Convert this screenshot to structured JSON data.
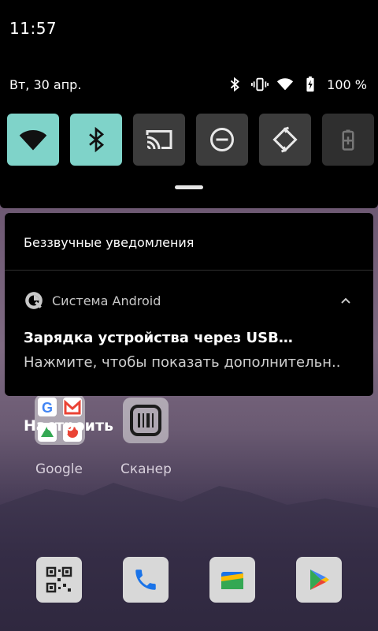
{
  "statusbar": {
    "time": "11:57",
    "date": "Вт, 30 апр.",
    "battery_percent": "100 %",
    "icons": [
      "bluetooth-icon",
      "vibrate-icon",
      "wifi-icon",
      "battery-charging-icon"
    ]
  },
  "quick_settings": {
    "tiles": [
      {
        "name": "wifi",
        "icon": "wifi-icon",
        "state": "on"
      },
      {
        "name": "bluetooth",
        "icon": "bluetooth-icon",
        "state": "on"
      },
      {
        "name": "cast",
        "icon": "cast-icon",
        "state": "off"
      },
      {
        "name": "do-not-disturb",
        "icon": "dnd-icon",
        "state": "off"
      },
      {
        "name": "auto-rotate",
        "icon": "rotate-icon",
        "state": "off"
      },
      {
        "name": "battery-saver",
        "icon": "battery-saver-icon",
        "state": "disabled"
      }
    ],
    "accent_color": "#7fd3c9"
  },
  "notifications": {
    "section_header": "Беззвучные уведомления",
    "items": [
      {
        "app_name": "Система Android",
        "title": "Зарядка устройства через USB…",
        "text": "Нажмите, чтобы показать дополнительн.."
      }
    ]
  },
  "configure_label": "Настроить",
  "home": {
    "apps": [
      {
        "label": "Google"
      },
      {
        "label": "Сканер"
      }
    ],
    "dock": [
      "qr-code-icon",
      "phone-icon",
      "files-icon",
      "play-store-icon"
    ]
  }
}
